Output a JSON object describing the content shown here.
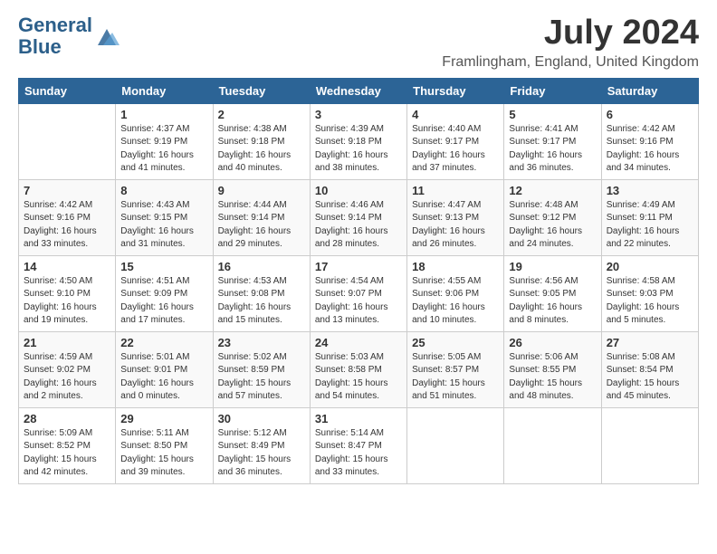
{
  "header": {
    "logo_line1": "General",
    "logo_line2": "Blue",
    "title": "July 2024",
    "subtitle": "Framlingham, England, United Kingdom"
  },
  "days_of_week": [
    "Sunday",
    "Monday",
    "Tuesday",
    "Wednesday",
    "Thursday",
    "Friday",
    "Saturday"
  ],
  "weeks": [
    [
      {
        "day": "",
        "info": ""
      },
      {
        "day": "1",
        "info": "Sunrise: 4:37 AM\nSunset: 9:19 PM\nDaylight: 16 hours\nand 41 minutes."
      },
      {
        "day": "2",
        "info": "Sunrise: 4:38 AM\nSunset: 9:18 PM\nDaylight: 16 hours\nand 40 minutes."
      },
      {
        "day": "3",
        "info": "Sunrise: 4:39 AM\nSunset: 9:18 PM\nDaylight: 16 hours\nand 38 minutes."
      },
      {
        "day": "4",
        "info": "Sunrise: 4:40 AM\nSunset: 9:17 PM\nDaylight: 16 hours\nand 37 minutes."
      },
      {
        "day": "5",
        "info": "Sunrise: 4:41 AM\nSunset: 9:17 PM\nDaylight: 16 hours\nand 36 minutes."
      },
      {
        "day": "6",
        "info": "Sunrise: 4:42 AM\nSunset: 9:16 PM\nDaylight: 16 hours\nand 34 minutes."
      }
    ],
    [
      {
        "day": "7",
        "info": "Sunrise: 4:42 AM\nSunset: 9:16 PM\nDaylight: 16 hours\nand 33 minutes."
      },
      {
        "day": "8",
        "info": "Sunrise: 4:43 AM\nSunset: 9:15 PM\nDaylight: 16 hours\nand 31 minutes."
      },
      {
        "day": "9",
        "info": "Sunrise: 4:44 AM\nSunset: 9:14 PM\nDaylight: 16 hours\nand 29 minutes."
      },
      {
        "day": "10",
        "info": "Sunrise: 4:46 AM\nSunset: 9:14 PM\nDaylight: 16 hours\nand 28 minutes."
      },
      {
        "day": "11",
        "info": "Sunrise: 4:47 AM\nSunset: 9:13 PM\nDaylight: 16 hours\nand 26 minutes."
      },
      {
        "day": "12",
        "info": "Sunrise: 4:48 AM\nSunset: 9:12 PM\nDaylight: 16 hours\nand 24 minutes."
      },
      {
        "day": "13",
        "info": "Sunrise: 4:49 AM\nSunset: 9:11 PM\nDaylight: 16 hours\nand 22 minutes."
      }
    ],
    [
      {
        "day": "14",
        "info": "Sunrise: 4:50 AM\nSunset: 9:10 PM\nDaylight: 16 hours\nand 19 minutes."
      },
      {
        "day": "15",
        "info": "Sunrise: 4:51 AM\nSunset: 9:09 PM\nDaylight: 16 hours\nand 17 minutes."
      },
      {
        "day": "16",
        "info": "Sunrise: 4:53 AM\nSunset: 9:08 PM\nDaylight: 16 hours\nand 15 minutes."
      },
      {
        "day": "17",
        "info": "Sunrise: 4:54 AM\nSunset: 9:07 PM\nDaylight: 16 hours\nand 13 minutes."
      },
      {
        "day": "18",
        "info": "Sunrise: 4:55 AM\nSunset: 9:06 PM\nDaylight: 16 hours\nand 10 minutes."
      },
      {
        "day": "19",
        "info": "Sunrise: 4:56 AM\nSunset: 9:05 PM\nDaylight: 16 hours\nand 8 minutes."
      },
      {
        "day": "20",
        "info": "Sunrise: 4:58 AM\nSunset: 9:03 PM\nDaylight: 16 hours\nand 5 minutes."
      }
    ],
    [
      {
        "day": "21",
        "info": "Sunrise: 4:59 AM\nSunset: 9:02 PM\nDaylight: 16 hours\nand 2 minutes."
      },
      {
        "day": "22",
        "info": "Sunrise: 5:01 AM\nSunset: 9:01 PM\nDaylight: 16 hours\nand 0 minutes."
      },
      {
        "day": "23",
        "info": "Sunrise: 5:02 AM\nSunset: 8:59 PM\nDaylight: 15 hours\nand 57 minutes."
      },
      {
        "day": "24",
        "info": "Sunrise: 5:03 AM\nSunset: 8:58 PM\nDaylight: 15 hours\nand 54 minutes."
      },
      {
        "day": "25",
        "info": "Sunrise: 5:05 AM\nSunset: 8:57 PM\nDaylight: 15 hours\nand 51 minutes."
      },
      {
        "day": "26",
        "info": "Sunrise: 5:06 AM\nSunset: 8:55 PM\nDaylight: 15 hours\nand 48 minutes."
      },
      {
        "day": "27",
        "info": "Sunrise: 5:08 AM\nSunset: 8:54 PM\nDaylight: 15 hours\nand 45 minutes."
      }
    ],
    [
      {
        "day": "28",
        "info": "Sunrise: 5:09 AM\nSunset: 8:52 PM\nDaylight: 15 hours\nand 42 minutes."
      },
      {
        "day": "29",
        "info": "Sunrise: 5:11 AM\nSunset: 8:50 PM\nDaylight: 15 hours\nand 39 minutes."
      },
      {
        "day": "30",
        "info": "Sunrise: 5:12 AM\nSunset: 8:49 PM\nDaylight: 15 hours\nand 36 minutes."
      },
      {
        "day": "31",
        "info": "Sunrise: 5:14 AM\nSunset: 8:47 PM\nDaylight: 15 hours\nand 33 minutes."
      },
      {
        "day": "",
        "info": ""
      },
      {
        "day": "",
        "info": ""
      },
      {
        "day": "",
        "info": ""
      }
    ]
  ]
}
